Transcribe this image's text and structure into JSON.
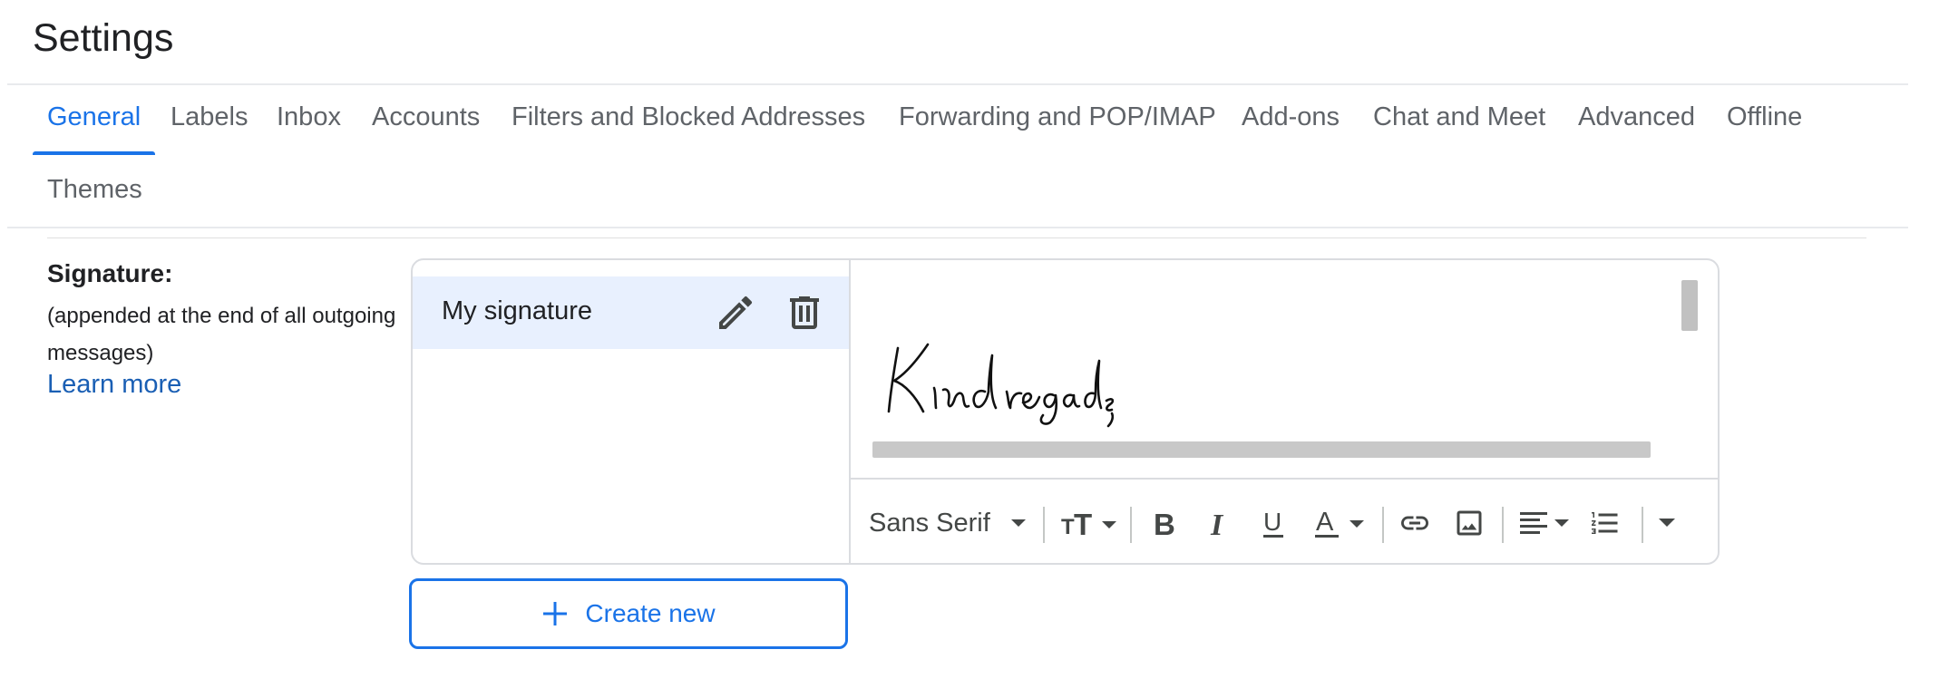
{
  "page": {
    "title": "Settings"
  },
  "tabs": [
    {
      "label": "General",
      "active": true
    },
    {
      "label": "Labels"
    },
    {
      "label": "Inbox"
    },
    {
      "label": "Accounts"
    },
    {
      "label": "Filters and Blocked Addresses"
    },
    {
      "label": "Forwarding and POP/IMAP"
    },
    {
      "label": "Add-ons"
    },
    {
      "label": "Chat and Meet"
    },
    {
      "label": "Advanced"
    },
    {
      "label": "Offline"
    },
    {
      "label": "Themes"
    }
  ],
  "signature": {
    "label": "Signature:",
    "description": "(appended at the end of all outgoing messages)",
    "learn_more": "Learn more",
    "items": [
      {
        "name": "My signature",
        "selected": true
      }
    ],
    "image_text": "Kind regards,",
    "create_new": "Create new"
  },
  "toolbar": {
    "font": "Sans Serif",
    "icons": [
      "text-size-icon",
      "bold-icon",
      "italic-icon",
      "underline-icon",
      "text-color-icon",
      "link-icon",
      "image-icon",
      "align-icon",
      "numbered-list-icon",
      "more-formatting-icon"
    ]
  },
  "colors": {
    "accent": "#1a73e8",
    "selected_bg": "#e8f0fe",
    "link": "#1a5fb4"
  }
}
